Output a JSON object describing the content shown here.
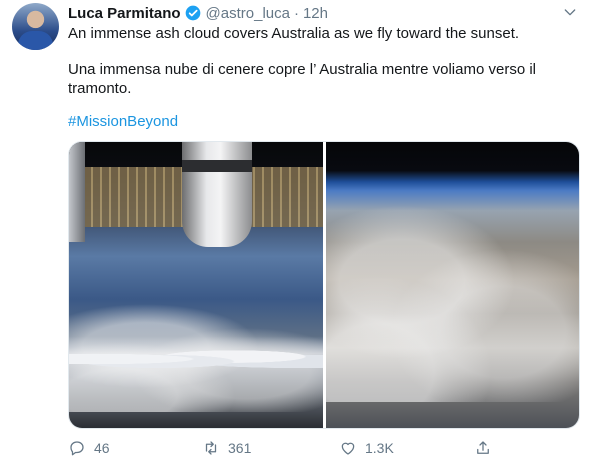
{
  "tweet": {
    "author_name": "Luca Parmitano",
    "handle": "@astro_luca",
    "separator": "·",
    "time": "12h",
    "text_en": "An immense ash cloud covers Australia as we fly toward the sunset.",
    "text_it": "Una immensa nube di cenere copre l’  Australia mentre voliamo verso il tramonto.",
    "hashtag": "#MissionBeyond"
  },
  "actions": {
    "replies": "46",
    "retweets": "361",
    "likes": "1.3K"
  },
  "icons": {
    "verified": "verified-badge-icon",
    "more": "chevron-down-icon",
    "reply": "reply-icon",
    "retweet": "retweet-icon",
    "like": "heart-icon",
    "share": "share-icon"
  },
  "colors": {
    "link": "#1b95e0",
    "verified": "#1da1f2",
    "secondary_text": "#657786"
  }
}
